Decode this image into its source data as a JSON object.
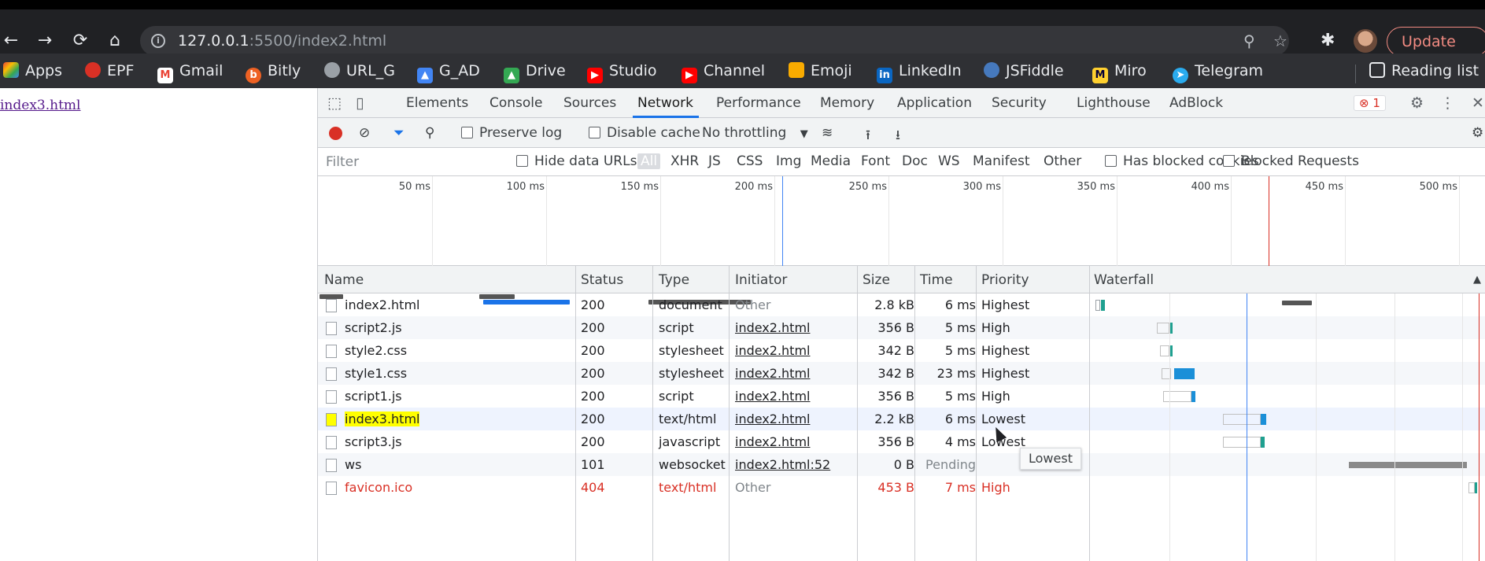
{
  "browser": {
    "url_host": "127.0.0.1",
    "url_rest": ":5500/index2.html",
    "update_label": "Update",
    "bookmarks": [
      {
        "label": "Apps",
        "icon": "apps-grid-icon",
        "color": "#ea4335"
      },
      {
        "label": "EPF",
        "icon": "epf-icon",
        "color": "#d93025"
      },
      {
        "label": "Gmail",
        "icon": "gmail-icon",
        "color": "#ea4335"
      },
      {
        "label": "Bitly",
        "icon": "bitly-icon",
        "color": "#ee6123"
      },
      {
        "label": "URL_G",
        "icon": "url-g-icon",
        "color": "#9aa0a6"
      },
      {
        "label": "G_AD",
        "icon": "google-ads-icon",
        "color": "#4285f4"
      },
      {
        "label": "Drive",
        "icon": "drive-icon",
        "color": "#34a853"
      },
      {
        "label": "Studio",
        "icon": "youtube-studio-icon",
        "color": "#ff0000"
      },
      {
        "label": "Channel",
        "icon": "youtube-icon",
        "color": "#ff0000"
      },
      {
        "label": "Emoji",
        "icon": "emoji-icon",
        "color": "#f9ab00"
      },
      {
        "label": "LinkedIn",
        "icon": "linkedin-icon",
        "color": "#0a66c2"
      },
      {
        "label": "JSFiddle",
        "icon": "jsfiddle-icon",
        "color": "#4679bd"
      },
      {
        "label": "Miro",
        "icon": "miro-icon",
        "color": "#ffd02f"
      },
      {
        "label": "Telegram",
        "icon": "telegram-icon",
        "color": "#2aabee"
      }
    ],
    "reading_list": "Reading list"
  },
  "page": {
    "link_text": "index3.html"
  },
  "devtools": {
    "tabs": [
      "Elements",
      "Console",
      "Sources",
      "Network",
      "Performance",
      "Memory",
      "Application",
      "Security",
      "Lighthouse",
      "AdBlock"
    ],
    "active_tab": "Network",
    "error_count": "1",
    "toolbar": {
      "preserve_log": "Preserve log",
      "disable_cache": "Disable cache",
      "throttling": "No throttling"
    },
    "filter": {
      "placeholder": "Filter",
      "hide_data_urls": "Hide data URLs",
      "types": [
        "All",
        "XHR",
        "JS",
        "CSS",
        "Img",
        "Media",
        "Font",
        "Doc",
        "WS",
        "Manifest",
        "Other"
      ],
      "has_blocked_cookies": "Has blocked cookies",
      "blocked_requests": "Blocked Requests"
    },
    "overview_ticks": [
      "50 ms",
      "100 ms",
      "150 ms",
      "200 ms",
      "250 ms",
      "300 ms",
      "350 ms",
      "400 ms",
      "450 ms",
      "500 ms"
    ],
    "columns": [
      "Name",
      "Status",
      "Type",
      "Initiator",
      "Size",
      "Time",
      "Priority",
      "Waterfall"
    ],
    "requests": [
      {
        "name": "index2.html",
        "status": "200",
        "type": "document",
        "initiator": "Other",
        "size": "2.8 kB",
        "time": "6 ms",
        "priority": "Highest"
      },
      {
        "name": "script2.js",
        "status": "200",
        "type": "script",
        "initiator": "index2.html",
        "size": "356 B",
        "time": "5 ms",
        "priority": "High"
      },
      {
        "name": "style2.css",
        "status": "200",
        "type": "stylesheet",
        "initiator": "index2.html",
        "size": "342 B",
        "time": "5 ms",
        "priority": "Highest"
      },
      {
        "name": "style1.css",
        "status": "200",
        "type": "stylesheet",
        "initiator": "index2.html",
        "size": "342 B",
        "time": "23 ms",
        "priority": "Highest"
      },
      {
        "name": "script1.js",
        "status": "200",
        "type": "script",
        "initiator": "index2.html",
        "size": "356 B",
        "time": "5 ms",
        "priority": "High"
      },
      {
        "name": "index3.html",
        "status": "200",
        "type": "text/html",
        "initiator": "index2.html",
        "size": "2.2 kB",
        "time": "6 ms",
        "priority": "Lowest"
      },
      {
        "name": "script3.js",
        "status": "200",
        "type": "javascript",
        "initiator": "index2.html",
        "size": "356 B",
        "time": "4 ms",
        "priority": "Lowest"
      },
      {
        "name": "ws",
        "status": "101",
        "type": "websocket",
        "initiator": "index2.html:52",
        "size": "0 B",
        "time": "Pending",
        "priority": ""
      },
      {
        "name": "favicon.ico",
        "status": "404",
        "type": "text/html",
        "initiator": "Other",
        "size": "453 B",
        "time": "7 ms",
        "priority": "High"
      }
    ],
    "tooltip": "Lowest"
  }
}
